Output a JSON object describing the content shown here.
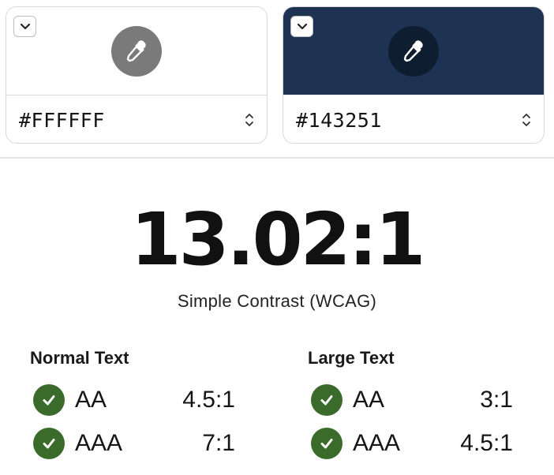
{
  "colors": {
    "foreground": {
      "hex": "#FFFFFF",
      "swatch": "#ffffff",
      "eyedropper_bg": "#7a7a7a"
    },
    "background": {
      "hex": "#143251",
      "swatch": "#1e3353",
      "eyedropper_bg": "#0f1d30"
    },
    "pass_green": "#3a6b2a"
  },
  "icons": {
    "toggle": "chevron-down-icon",
    "eyedropper": "eyedropper-icon",
    "stepper": "chevron-up-down-icon",
    "check": "checkmark-icon"
  },
  "contrast": {
    "ratio": "13.02:1",
    "caption": "Simple Contrast (WCAG)"
  },
  "normal_text": {
    "heading": "Normal Text",
    "aa": {
      "label": "AA",
      "required": "4.5:1",
      "pass": true
    },
    "aaa": {
      "label": "AAA",
      "required": "7:1",
      "pass": true
    }
  },
  "large_text": {
    "heading": "Large Text",
    "aa": {
      "label": "AA",
      "required": "3:1",
      "pass": true
    },
    "aaa": {
      "label": "AAA",
      "required": "4.5:1",
      "pass": true
    }
  }
}
